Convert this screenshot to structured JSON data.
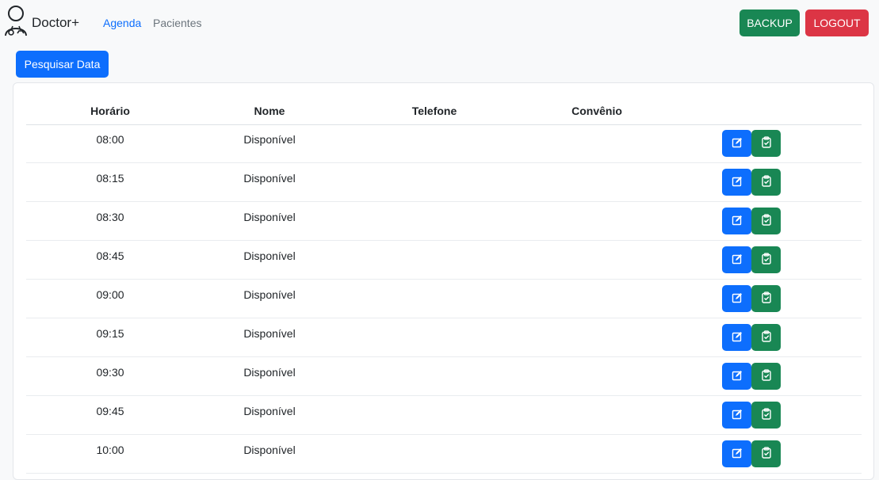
{
  "navbar": {
    "brand": "Doctor+",
    "links": [
      {
        "label": "Agenda"
      },
      {
        "label": "Pacientes"
      }
    ],
    "backup_label": "BACKUP",
    "logout_label": "LOGOUT"
  },
  "toolbar": {
    "search_label": "Pesquisar Data"
  },
  "table": {
    "headers": [
      "Horário",
      "Nome",
      "Telefone",
      "Convênio"
    ],
    "rows": [
      {
        "time": "08:00",
        "name": "Disponível",
        "phone": "",
        "insurance": ""
      },
      {
        "time": "08:15",
        "name": "Disponível",
        "phone": "",
        "insurance": ""
      },
      {
        "time": "08:30",
        "name": "Disponível",
        "phone": "",
        "insurance": ""
      },
      {
        "time": "08:45",
        "name": "Disponível",
        "phone": "",
        "insurance": ""
      },
      {
        "time": "09:00",
        "name": "Disponível",
        "phone": "",
        "insurance": ""
      },
      {
        "time": "09:15",
        "name": "Disponível",
        "phone": "",
        "insurance": ""
      },
      {
        "time": "09:30",
        "name": "Disponível",
        "phone": "",
        "insurance": ""
      },
      {
        "time": "09:45",
        "name": "Disponível",
        "phone": "",
        "insurance": ""
      },
      {
        "time": "10:00",
        "name": "Disponível",
        "phone": "",
        "insurance": ""
      }
    ]
  },
  "colors": {
    "primary": "#0d6efd",
    "success": "#198754",
    "danger": "#dc3545"
  },
  "icons": {
    "brand": "doctor-icon",
    "edit": "edit-icon",
    "clipboard": "clipboard-check-icon"
  }
}
